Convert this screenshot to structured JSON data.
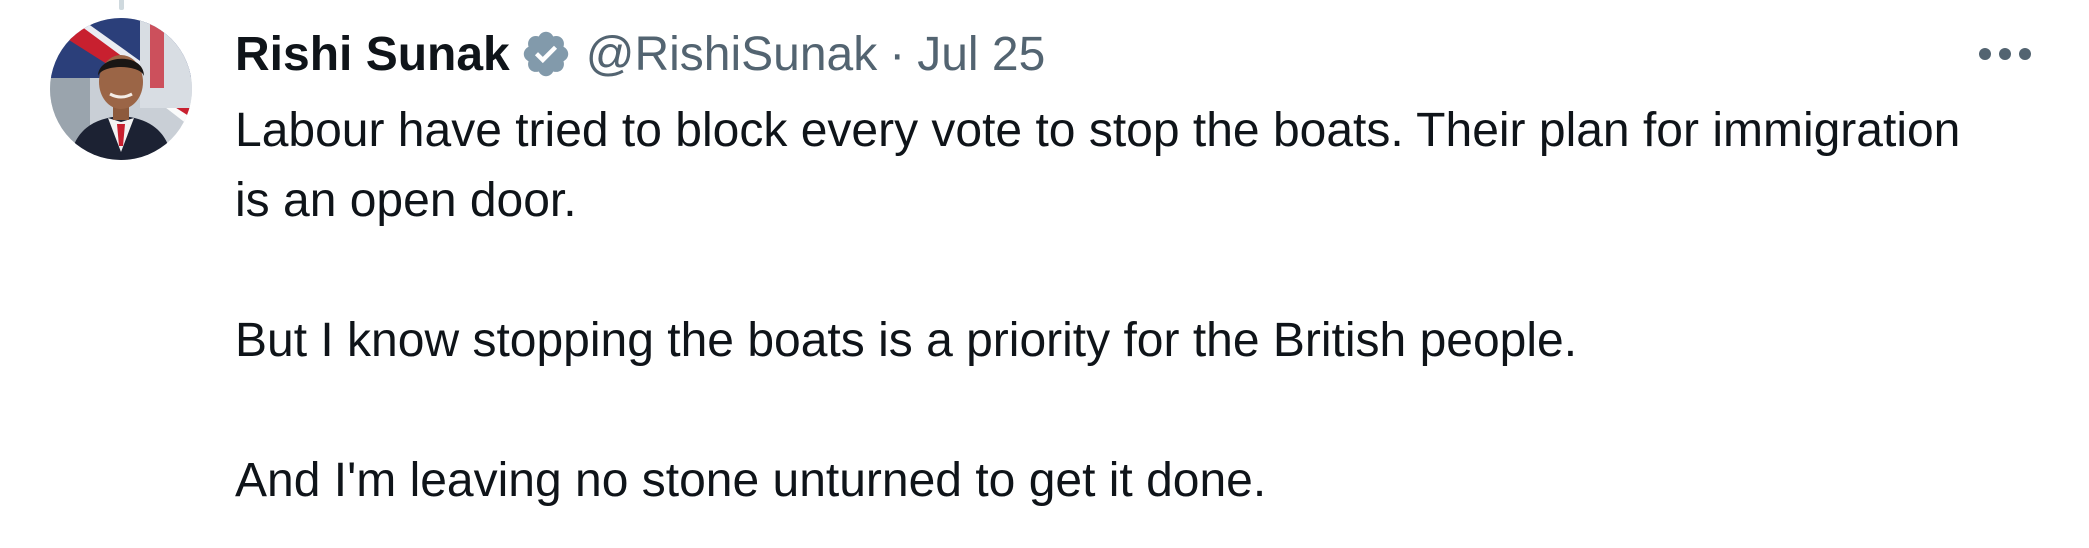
{
  "tweet": {
    "author": {
      "display_name": "Rishi Sunak",
      "handle": "@RishiSunak",
      "verified": true,
      "verified_badge_color": "#829aab",
      "avatar_icon": "profile-photo"
    },
    "separator": "·",
    "date": "Jul 25",
    "more_icon": "ellipsis-icon",
    "paragraphs": [
      {
        "text": "Labour have tried to block every vote to stop the boats. Their plan for immigration is an open door."
      },
      {
        "text": "But I know stopping the boats is a priority for the British people."
      },
      {
        "text": "And I'm leaving no stone unturned to get it done."
      }
    ]
  },
  "colors": {
    "text_primary": "#0f1419",
    "text_secondary": "#536471",
    "thread_line": "#cfd9de"
  }
}
